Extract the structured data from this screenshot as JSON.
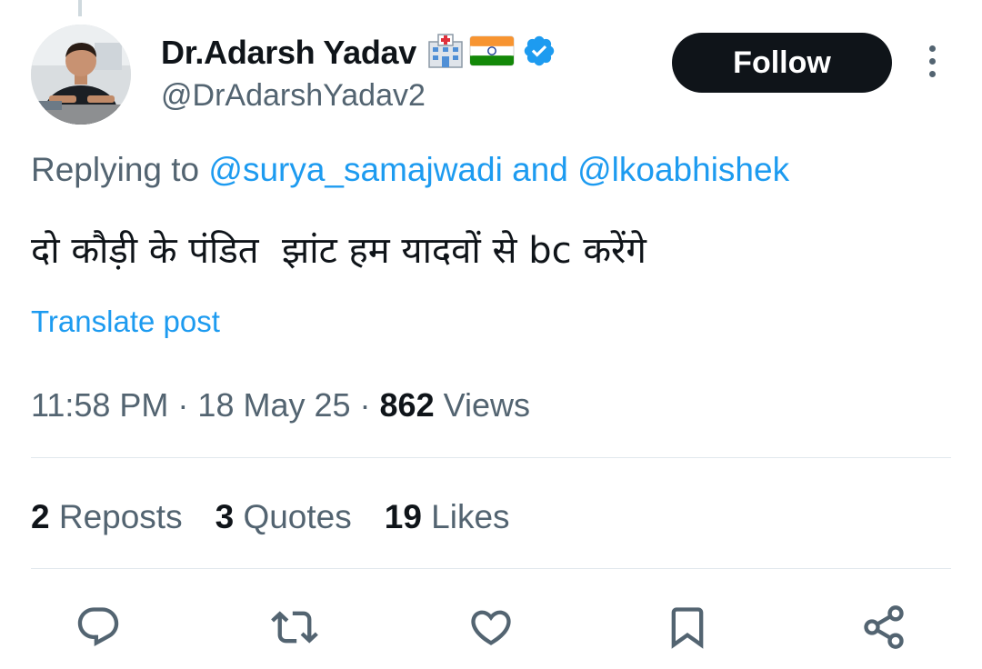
{
  "author": {
    "display_name": "Dr.Adarsh Yadav",
    "handle": "@DrAdarshYadav2",
    "name_icons": [
      "hospital-emoji-icon",
      "india-flag-emoji-icon",
      "verified-badge-icon"
    ]
  },
  "header": {
    "follow_label": "Follow",
    "more_icon": "more-vertical-icon"
  },
  "reply": {
    "prefix": "Replying to ",
    "mention1": "@surya_samajwadi",
    "joiner": " and ",
    "mention2": "@lkoabhishek"
  },
  "tweet": {
    "text": "दो कौड़ी के पंडित  झांट हम यादवों से bc करेंगे",
    "translate_label": "Translate post"
  },
  "meta": {
    "time": "11:58 PM",
    "separator": " · ",
    "date": "18 May 25",
    "views_count": "862",
    "views_label": " Views"
  },
  "stats": {
    "reposts_count": "2",
    "reposts_label": " Reposts",
    "quotes_count": "3",
    "quotes_label": " Quotes",
    "likes_count": "19",
    "likes_label": " Likes"
  },
  "actions": [
    "reply-icon",
    "retweet-icon",
    "like-icon",
    "bookmark-icon",
    "share-icon"
  ],
  "colors": {
    "accent": "#1d9bf0",
    "text_primary": "#0f1419",
    "text_secondary": "#536471",
    "divider": "#e1e8ed"
  }
}
